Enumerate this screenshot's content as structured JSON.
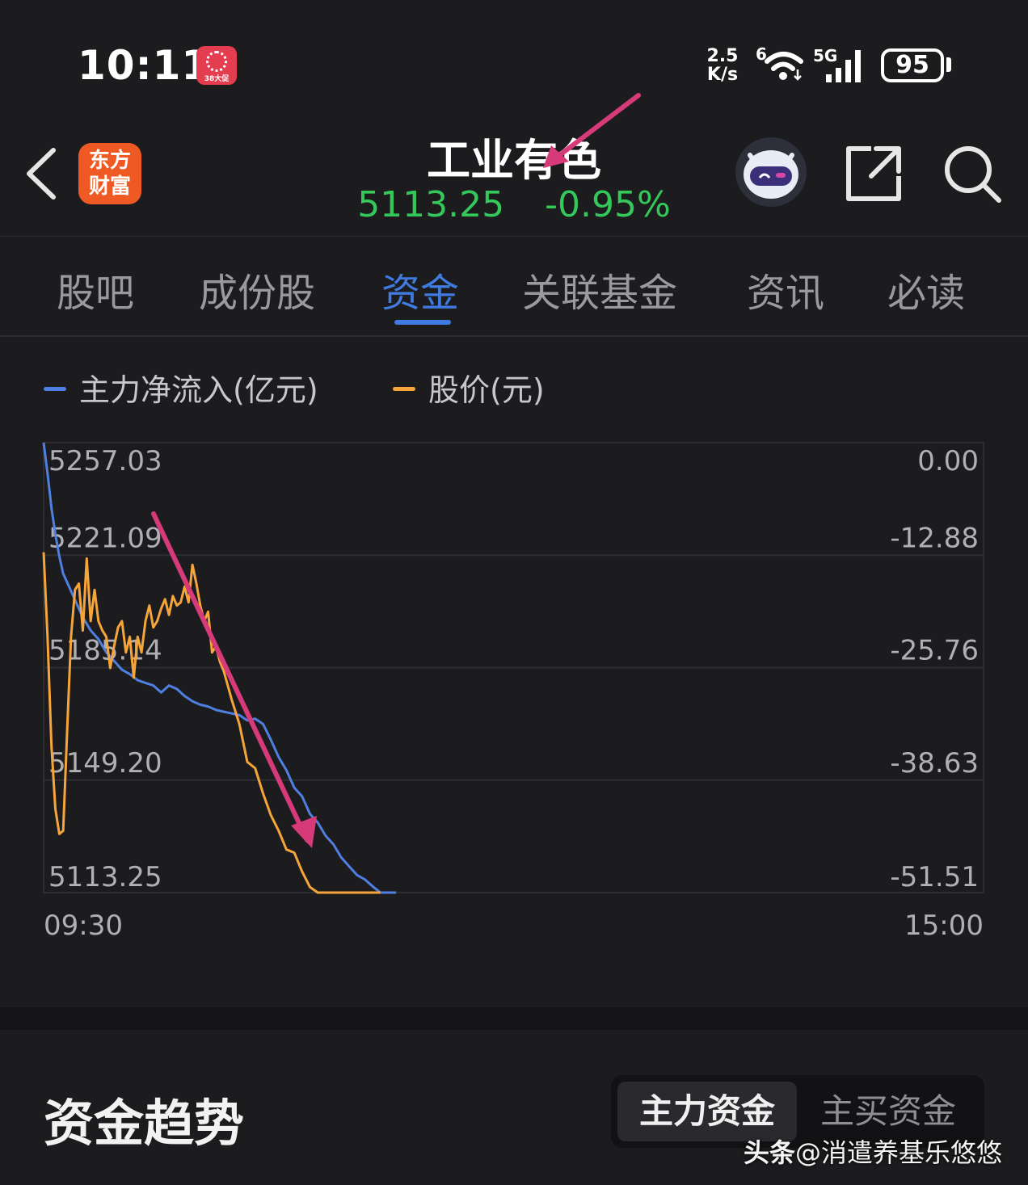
{
  "status_bar": {
    "time": "10:11",
    "app_badge_text": "38大促",
    "net_speed_value": "2.5",
    "net_speed_unit": "K/s",
    "wifi_label": "6",
    "cell_label": "5G",
    "battery": "95"
  },
  "header": {
    "logo_line1": "东方",
    "logo_line2": "财富",
    "title": "工业有色",
    "price": "5113.25",
    "change": "-0.95%"
  },
  "tabs": [
    "股吧",
    "成份股",
    "资金",
    "关联基金",
    "资讯",
    "必读"
  ],
  "active_tab_index": 2,
  "colors": {
    "accent_blue": "#3f7be0",
    "down_green": "#34c759",
    "series_blue": "#4f7fe0",
    "series_orange": "#f5a53a",
    "annotation_arrow": "#d63a78"
  },
  "chart_data": {
    "type": "line",
    "legend": [
      {
        "name": "主力净流入(亿元)",
        "color": "#4f7fe0"
      },
      {
        "name": "股价(元)",
        "color": "#f5a53a"
      }
    ],
    "y_left_ticks": [
      "5257.03",
      "5221.09",
      "5185.14",
      "5149.20",
      "5113.25"
    ],
    "y_right_ticks": [
      "0.00",
      "-12.88",
      "-25.76",
      "-38.63",
      "-51.51"
    ],
    "x_ticks": [
      "09:30",
      "15:00"
    ],
    "x_range_minutes": [
      0,
      240
    ],
    "y_left_range": [
      5113.25,
      5257.03
    ],
    "y_right_range": [
      -51.51,
      0
    ],
    "grid": true,
    "series": [
      {
        "name": "主力净流入(亿元)",
        "axis": "right",
        "x": [
          0,
          1,
          2,
          3,
          4,
          5,
          6,
          8,
          10,
          12,
          14,
          16,
          18,
          20,
          22,
          24,
          26,
          28,
          30,
          32,
          34,
          36,
          38,
          40,
          42,
          44,
          46,
          48,
          50,
          52,
          54,
          56,
          58,
          60,
          62,
          64,
          66,
          68,
          70,
          72,
          74,
          76,
          78,
          80,
          82,
          84,
          86,
          88,
          90
        ],
        "values": [
          0,
          -3.5,
          -7.5,
          -10.5,
          -13,
          -15,
          -16,
          -18,
          -20,
          -21.5,
          -22.5,
          -24,
          -25,
          -26,
          -26.5,
          -27.2,
          -27.5,
          -27.8,
          -28.6,
          -27.8,
          -28.2,
          -29,
          -29.6,
          -30,
          -30.2,
          -30.6,
          -30.8,
          -31.0,
          -31.2,
          -31.8,
          -31.6,
          -32.2,
          -34,
          -36,
          -37.5,
          -39.5,
          -40.5,
          -42.5,
          -43.5,
          -45,
          -46,
          -47.5,
          -48.5,
          -49.5,
          -50,
          -50.8,
          -51.5,
          -51.51,
          -51.51
        ]
      },
      {
        "name": "股价(元)",
        "axis": "left",
        "x": [
          0,
          1,
          2,
          3,
          4,
          5,
          6,
          7,
          8,
          9,
          10,
          11,
          12,
          13,
          14,
          15,
          16,
          17,
          18,
          19,
          20,
          21,
          22,
          23,
          24,
          25,
          26,
          27,
          28,
          29,
          30,
          31,
          32,
          33,
          34,
          35,
          36,
          37,
          38,
          39,
          40,
          41,
          42,
          43,
          44,
          45,
          46,
          48,
          50,
          52,
          54,
          56,
          58,
          60,
          62,
          64,
          66,
          68,
          70,
          72,
          74,
          76,
          78,
          80,
          82,
          84,
          86
        ],
        "values": [
          5222,
          5195,
          5160,
          5140,
          5132,
          5133,
          5165,
          5195,
          5210,
          5212,
          5197,
          5220,
          5200,
          5210,
          5200,
          5197,
          5195,
          5185,
          5192,
          5198,
          5200,
          5190,
          5195,
          5182,
          5195,
          5190,
          5200,
          5205,
          5198,
          5200,
          5204,
          5207,
          5202,
          5208,
          5205,
          5206,
          5211,
          5206,
          5218,
          5212,
          5205,
          5200,
          5203,
          5190,
          5192,
          5187,
          5184,
          5175,
          5167,
          5155,
          5153,
          5145,
          5138,
          5133,
          5127,
          5126,
          5120,
          5115,
          5113.25,
          5113.25,
          5113.25,
          5113.25,
          5113.25,
          5113.25,
          5113.25,
          5113.25,
          5113.25
        ]
      }
    ]
  },
  "section": {
    "title": "资金趋势",
    "options": [
      "主力资金",
      "主买资金"
    ]
  },
  "watermark": {
    "prefix": "头条",
    "handle": "@消遣养基乐悠悠"
  }
}
